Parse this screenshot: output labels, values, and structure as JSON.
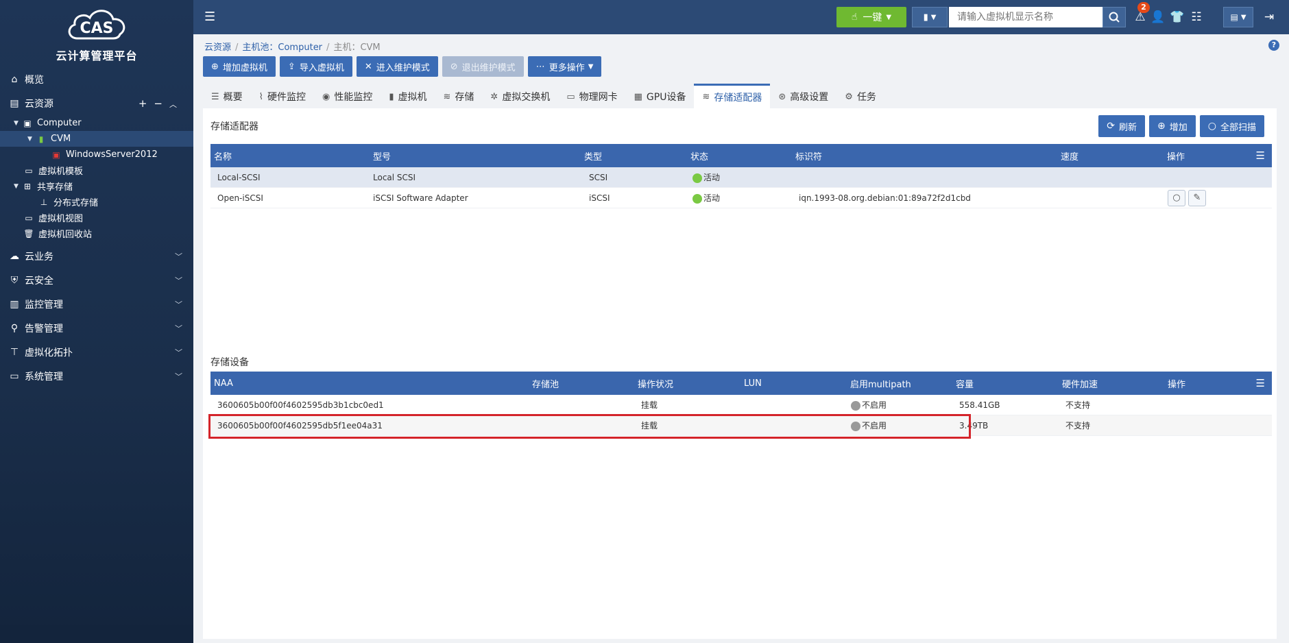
{
  "sidebar": {
    "logo_text": "CAS",
    "platform_title": "云计算管理平台",
    "items": [
      {
        "label": "概览"
      },
      {
        "label": "云资源",
        "add": "+",
        "remove": "−"
      },
      {
        "label": "云业务"
      },
      {
        "label": "云安全"
      },
      {
        "label": "监控管理"
      },
      {
        "label": "告警管理"
      },
      {
        "label": "虚拟化拓扑"
      },
      {
        "label": "系统管理"
      }
    ],
    "tree": {
      "computer": "Computer",
      "cvm": "CVM",
      "vm": "WindowsServer2012",
      "vm_template": "虚拟机模板",
      "shared_storage": "共享存储",
      "distributed_storage": "分布式存储",
      "vm_view": "虚拟机视图",
      "vm_recycle": "虚拟机回收站"
    }
  },
  "topbar": {
    "one_key_label": "一键",
    "search_placeholder": "请输入虚拟机显示名称",
    "alert_count": "2"
  },
  "breadcrumb": {
    "cloud_resources": "云资源",
    "host_pool": "主机池：Computer",
    "host": "主机：CVM"
  },
  "actions": {
    "add_vm": "增加虚拟机",
    "import_vm": "导入虚拟机",
    "enter_maintenance": "进入维护模式",
    "exit_maintenance": "退出维护模式",
    "more_ops": "更多操作"
  },
  "tabs": [
    {
      "label": "概要"
    },
    {
      "label": "硬件监控"
    },
    {
      "label": "性能监控"
    },
    {
      "label": "虚拟机"
    },
    {
      "label": "存储"
    },
    {
      "label": "虚拟交换机"
    },
    {
      "label": "物理网卡"
    },
    {
      "label": "GPU设备"
    },
    {
      "label": "存储适配器"
    },
    {
      "label": "高级设置"
    },
    {
      "label": "任务"
    }
  ],
  "adapters": {
    "title": "存储适配器",
    "refresh": "刷新",
    "add": "增加",
    "scan_all": "全部扫描",
    "columns": [
      "名称",
      "型号",
      "类型",
      "状态",
      "标识符",
      "速度",
      "操作"
    ],
    "rows": [
      {
        "name": "Local-SCSI",
        "model": "Local SCSI",
        "type": "SCSI",
        "status": "活动",
        "identifier": "",
        "speed": ""
      },
      {
        "name": "Open-iSCSI",
        "model": "iSCSI Software Adapter",
        "type": "iSCSI",
        "status": "活动",
        "identifier": "iqn.1993-08.org.debian:01:89a72f2d1cbd",
        "speed": ""
      }
    ]
  },
  "devices": {
    "title": "存储设备",
    "columns": [
      "NAA",
      "存储池",
      "操作状况",
      "LUN",
      "启用multipath",
      "容量",
      "硬件加速",
      "操作"
    ],
    "rows": [
      {
        "naa": "3600605b00f00f4602595db3b1cbc0ed1",
        "pool": "",
        "op_status": "挂载",
        "lun": "",
        "multipath": "不启用",
        "capacity": "558.41GB",
        "hw_accel": "不支持"
      },
      {
        "naa": "3600605b00f00f4602595db5f1ee04a31",
        "pool": "",
        "op_status": "挂载",
        "lun": "",
        "multipath": "不启用",
        "capacity": "3.49TB",
        "hw_accel": "不支持"
      }
    ]
  },
  "colors": {
    "accent": "#3b6cb5",
    "sidebar": "#1e3556",
    "topbar": "#2c4a75",
    "green": "#6fb931",
    "highlight": "#d4242a"
  }
}
